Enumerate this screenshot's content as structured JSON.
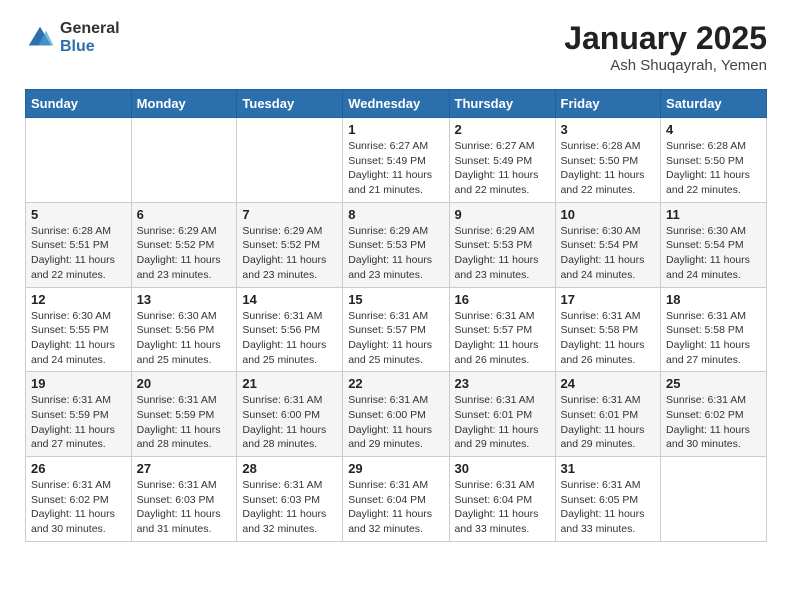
{
  "header": {
    "logo_general": "General",
    "logo_blue": "Blue",
    "month_title": "January 2025",
    "location": "Ash Shuqayrah, Yemen"
  },
  "days_of_week": [
    "Sunday",
    "Monday",
    "Tuesday",
    "Wednesday",
    "Thursday",
    "Friday",
    "Saturday"
  ],
  "weeks": [
    [
      {
        "day": "",
        "info": ""
      },
      {
        "day": "",
        "info": ""
      },
      {
        "day": "",
        "info": ""
      },
      {
        "day": "1",
        "info": "Sunrise: 6:27 AM\nSunset: 5:49 PM\nDaylight: 11 hours and 21 minutes."
      },
      {
        "day": "2",
        "info": "Sunrise: 6:27 AM\nSunset: 5:49 PM\nDaylight: 11 hours and 22 minutes."
      },
      {
        "day": "3",
        "info": "Sunrise: 6:28 AM\nSunset: 5:50 PM\nDaylight: 11 hours and 22 minutes."
      },
      {
        "day": "4",
        "info": "Sunrise: 6:28 AM\nSunset: 5:50 PM\nDaylight: 11 hours and 22 minutes."
      }
    ],
    [
      {
        "day": "5",
        "info": "Sunrise: 6:28 AM\nSunset: 5:51 PM\nDaylight: 11 hours and 22 minutes."
      },
      {
        "day": "6",
        "info": "Sunrise: 6:29 AM\nSunset: 5:52 PM\nDaylight: 11 hours and 23 minutes."
      },
      {
        "day": "7",
        "info": "Sunrise: 6:29 AM\nSunset: 5:52 PM\nDaylight: 11 hours and 23 minutes."
      },
      {
        "day": "8",
        "info": "Sunrise: 6:29 AM\nSunset: 5:53 PM\nDaylight: 11 hours and 23 minutes."
      },
      {
        "day": "9",
        "info": "Sunrise: 6:29 AM\nSunset: 5:53 PM\nDaylight: 11 hours and 23 minutes."
      },
      {
        "day": "10",
        "info": "Sunrise: 6:30 AM\nSunset: 5:54 PM\nDaylight: 11 hours and 24 minutes."
      },
      {
        "day": "11",
        "info": "Sunrise: 6:30 AM\nSunset: 5:54 PM\nDaylight: 11 hours and 24 minutes."
      }
    ],
    [
      {
        "day": "12",
        "info": "Sunrise: 6:30 AM\nSunset: 5:55 PM\nDaylight: 11 hours and 24 minutes."
      },
      {
        "day": "13",
        "info": "Sunrise: 6:30 AM\nSunset: 5:56 PM\nDaylight: 11 hours and 25 minutes."
      },
      {
        "day": "14",
        "info": "Sunrise: 6:31 AM\nSunset: 5:56 PM\nDaylight: 11 hours and 25 minutes."
      },
      {
        "day": "15",
        "info": "Sunrise: 6:31 AM\nSunset: 5:57 PM\nDaylight: 11 hours and 25 minutes."
      },
      {
        "day": "16",
        "info": "Sunrise: 6:31 AM\nSunset: 5:57 PM\nDaylight: 11 hours and 26 minutes."
      },
      {
        "day": "17",
        "info": "Sunrise: 6:31 AM\nSunset: 5:58 PM\nDaylight: 11 hours and 26 minutes."
      },
      {
        "day": "18",
        "info": "Sunrise: 6:31 AM\nSunset: 5:58 PM\nDaylight: 11 hours and 27 minutes."
      }
    ],
    [
      {
        "day": "19",
        "info": "Sunrise: 6:31 AM\nSunset: 5:59 PM\nDaylight: 11 hours and 27 minutes."
      },
      {
        "day": "20",
        "info": "Sunrise: 6:31 AM\nSunset: 5:59 PM\nDaylight: 11 hours and 28 minutes."
      },
      {
        "day": "21",
        "info": "Sunrise: 6:31 AM\nSunset: 6:00 PM\nDaylight: 11 hours and 28 minutes."
      },
      {
        "day": "22",
        "info": "Sunrise: 6:31 AM\nSunset: 6:00 PM\nDaylight: 11 hours and 29 minutes."
      },
      {
        "day": "23",
        "info": "Sunrise: 6:31 AM\nSunset: 6:01 PM\nDaylight: 11 hours and 29 minutes."
      },
      {
        "day": "24",
        "info": "Sunrise: 6:31 AM\nSunset: 6:01 PM\nDaylight: 11 hours and 29 minutes."
      },
      {
        "day": "25",
        "info": "Sunrise: 6:31 AM\nSunset: 6:02 PM\nDaylight: 11 hours and 30 minutes."
      }
    ],
    [
      {
        "day": "26",
        "info": "Sunrise: 6:31 AM\nSunset: 6:02 PM\nDaylight: 11 hours and 30 minutes."
      },
      {
        "day": "27",
        "info": "Sunrise: 6:31 AM\nSunset: 6:03 PM\nDaylight: 11 hours and 31 minutes."
      },
      {
        "day": "28",
        "info": "Sunrise: 6:31 AM\nSunset: 6:03 PM\nDaylight: 11 hours and 32 minutes."
      },
      {
        "day": "29",
        "info": "Sunrise: 6:31 AM\nSunset: 6:04 PM\nDaylight: 11 hours and 32 minutes."
      },
      {
        "day": "30",
        "info": "Sunrise: 6:31 AM\nSunset: 6:04 PM\nDaylight: 11 hours and 33 minutes."
      },
      {
        "day": "31",
        "info": "Sunrise: 6:31 AM\nSunset: 6:05 PM\nDaylight: 11 hours and 33 minutes."
      },
      {
        "day": "",
        "info": ""
      }
    ]
  ]
}
